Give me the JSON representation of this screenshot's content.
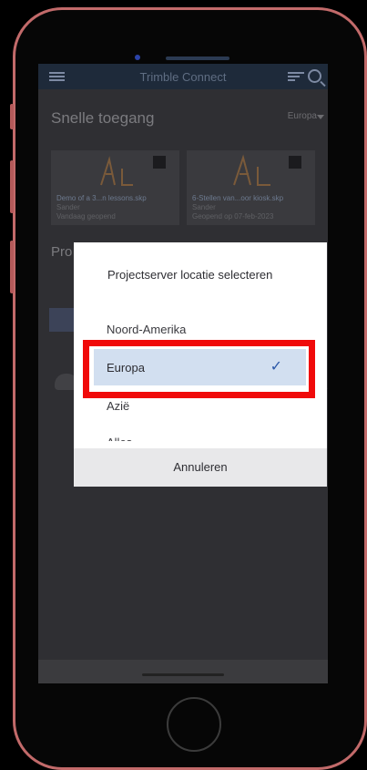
{
  "app": {
    "title": "Trimble Connect"
  },
  "home": {
    "quick_access_title": "Snelle toegang",
    "region_selected": "Europa",
    "cards": [
      {
        "name": "Demo of a 3...n lessons.skp",
        "user": "Sander",
        "date": "Vandaag geopend"
      },
      {
        "name": "6-Stellen van...oor kiosk.skp",
        "user": "Sander",
        "date": "Geopend op 07-feb-2023"
      }
    ],
    "projects_title": "Pro"
  },
  "dialog": {
    "title": "Projectserver locatie selecteren",
    "options": [
      "Noord-Amerika",
      "Europa",
      "Azië",
      "Alles"
    ],
    "selected": "Europa",
    "cancel_label": "Annuleren"
  },
  "colors": {
    "highlight": "#f00a0a",
    "selected_bg": "#d2dff0",
    "check": "#2c58a8"
  }
}
